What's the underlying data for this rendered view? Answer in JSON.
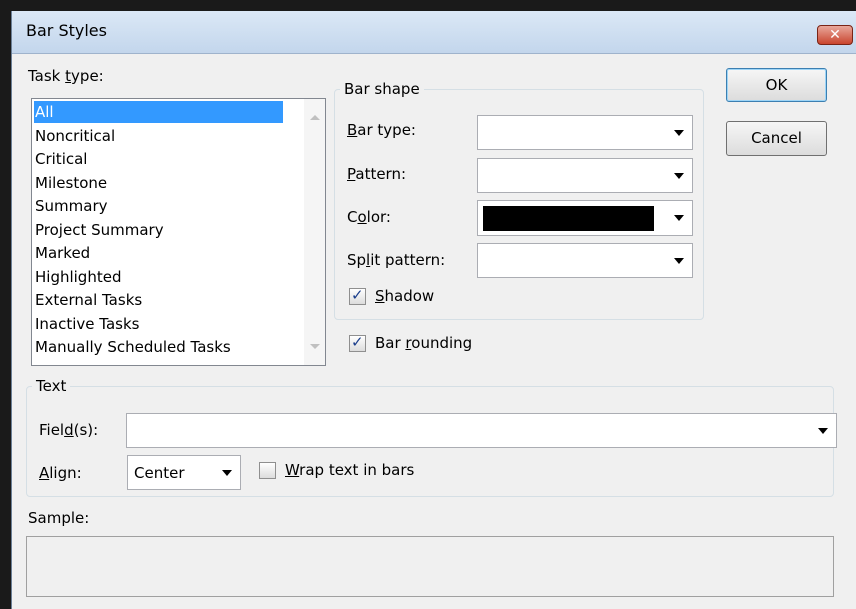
{
  "window": {
    "title": "Bar Styles",
    "close_label": "✕"
  },
  "task_type": {
    "label_pre": "Task ",
    "label_ul": "t",
    "label_post": "ype:",
    "items": [
      "All",
      "Noncritical",
      "Critical",
      "Milestone",
      "Summary",
      "Project Summary",
      "Marked",
      "Highlighted",
      "External Tasks",
      "Inactive Tasks",
      "Manually Scheduled Tasks"
    ],
    "selected_index": 0
  },
  "bar_shape": {
    "group_title": "Bar shape",
    "bar_type": {
      "ul": "B",
      "rest": "ar type:",
      "value": ""
    },
    "pattern": {
      "ul": "P",
      "rest": "attern:",
      "value": ""
    },
    "color": {
      "pre": "C",
      "ul": "o",
      "rest": "lor:",
      "swatch": "#000000"
    },
    "split_pattern": {
      "pre": "Sp",
      "ul": "l",
      "rest": "it pattern:",
      "value": ""
    },
    "shadow": {
      "ul": "S",
      "rest": "hadow",
      "checked": true
    }
  },
  "bar_rounding": {
    "pre": "Bar ",
    "ul": "r",
    "rest": "ounding",
    "checked": true
  },
  "text_group": {
    "group_title": "Text",
    "fields": {
      "pre": "Fiel",
      "ul": "d",
      "rest": "(s):",
      "value": ""
    },
    "align": {
      "ul": "A",
      "rest": "lign:",
      "value": "Center"
    },
    "wrap": {
      "ul": "W",
      "rest": "rap text in bars",
      "checked": false
    }
  },
  "sample": {
    "label": "Sample:"
  },
  "buttons": {
    "ok": "OK",
    "cancel": "Cancel"
  }
}
